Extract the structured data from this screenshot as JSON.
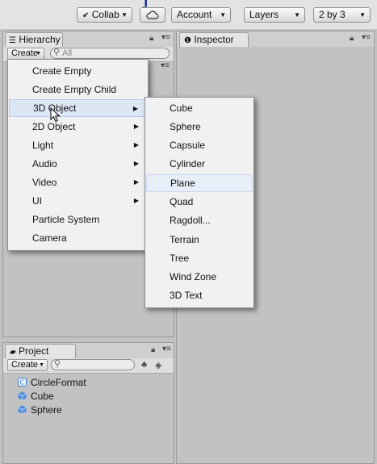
{
  "toolbar": {
    "collab_label": "Collab",
    "account_label": "Account",
    "layers_label": "Layers",
    "layout_label": "2 by 3"
  },
  "hierarchy": {
    "tab_label": "Hierarchy",
    "create_label": "Create",
    "search_placeholder": "All"
  },
  "inspector": {
    "tab_label": "Inspector"
  },
  "create_menu": {
    "items": [
      {
        "label": "Create Empty",
        "submenu": false
      },
      {
        "label": "Create Empty Child",
        "submenu": false
      },
      {
        "label": "3D Object",
        "submenu": true
      },
      {
        "label": "2D Object",
        "submenu": true
      },
      {
        "label": "Light",
        "submenu": true
      },
      {
        "label": "Audio",
        "submenu": true
      },
      {
        "label": "Video",
        "submenu": true
      },
      {
        "label": "UI",
        "submenu": true
      },
      {
        "label": "Particle System",
        "submenu": false
      },
      {
        "label": "Camera",
        "submenu": false
      }
    ],
    "highlighted": "3D Object"
  },
  "object_submenu": {
    "items": [
      "Cube",
      "Sphere",
      "Capsule",
      "Cylinder",
      "Plane",
      "Quad",
      "Ragdoll...",
      "Terrain",
      "Tree",
      "Wind Zone",
      "3D Text"
    ],
    "highlighted": "Plane"
  },
  "project": {
    "tab_label": "Project",
    "create_label": "Create",
    "assets": [
      {
        "name": "CircleFormat",
        "icon": "script-icon"
      },
      {
        "name": "Cube",
        "icon": "prefab-cube-icon"
      },
      {
        "name": "Sphere",
        "icon": "prefab-cube-icon"
      }
    ]
  },
  "colors": {
    "panel_bg": "#c2c2c2",
    "menu_bg": "#f1f1f1",
    "menu_highlight": "#dde6f5",
    "asset_blue": "#3d7fd6"
  }
}
